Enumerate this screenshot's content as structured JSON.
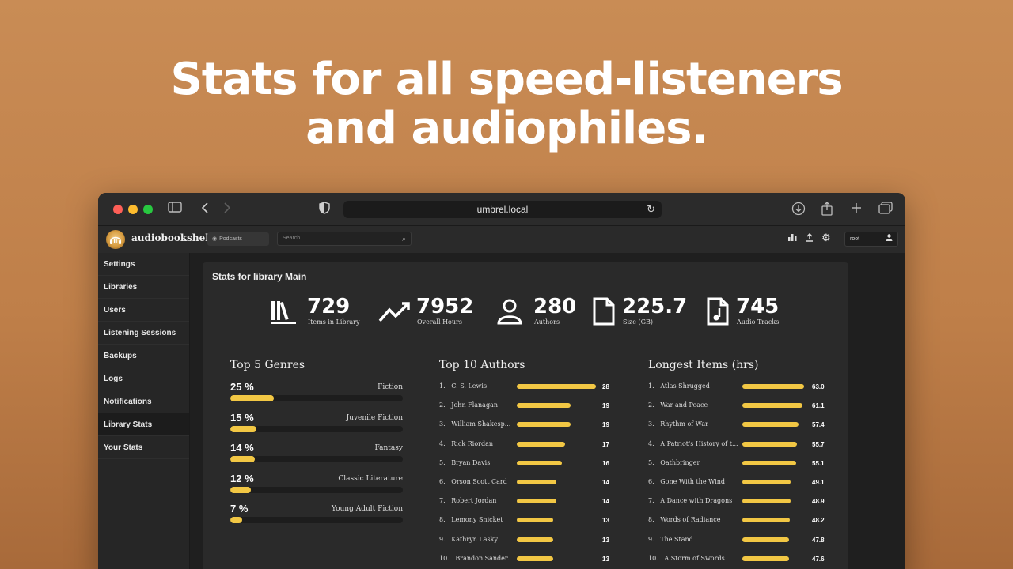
{
  "hero": {
    "line1": "Stats for all speed-listeners",
    "line2": "and audiophiles."
  },
  "browser": {
    "url": "umbrel.local",
    "icons": [
      "sidebar-icon",
      "back-icon",
      "forward-icon",
      "shield-icon",
      "reload-icon",
      "download-icon",
      "share-icon",
      "new-tab-icon",
      "tabs-icon"
    ]
  },
  "app": {
    "brand": "audiobookshelf",
    "library_select": "Podcasts",
    "search_placeholder": "Search..",
    "user": "root"
  },
  "sidebar": {
    "items": [
      {
        "label": "Settings"
      },
      {
        "label": "Libraries"
      },
      {
        "label": "Users"
      },
      {
        "label": "Listening Sessions"
      },
      {
        "label": "Backups"
      },
      {
        "label": "Logs"
      },
      {
        "label": "Notifications"
      },
      {
        "label": "Library Stats"
      },
      {
        "label": "Your Stats"
      }
    ],
    "active": "Library Stats"
  },
  "stats": {
    "title": "Stats for library Main",
    "items": [
      {
        "value": "729",
        "label": "Items in Library",
        "icon": "books-icon"
      },
      {
        "value": "7952",
        "label": "Overall Hours",
        "icon": "trend-icon"
      },
      {
        "value": "280",
        "label": "Authors",
        "icon": "person-icon"
      },
      {
        "value": "225.7",
        "label": "Size (GB)",
        "icon": "file-icon"
      },
      {
        "value": "745",
        "label": "Audio Tracks",
        "icon": "audio-file-icon"
      }
    ]
  },
  "genres": {
    "title": "Top 5 Genres",
    "items": [
      {
        "pct": "25 %",
        "name": "Fiction",
        "value": 25
      },
      {
        "pct": "15 %",
        "name": "Juvenile Fiction",
        "value": 15
      },
      {
        "pct": "14 %",
        "name": "Fantasy",
        "value": 14
      },
      {
        "pct": "12 %",
        "name": "Classic Literature",
        "value": 12
      },
      {
        "pct": "7 %",
        "name": "Young Adult Fiction",
        "value": 7
      }
    ]
  },
  "authors": {
    "title": "Top 10 Authors",
    "items": [
      {
        "rank": "1.",
        "name": "C. S. Lewis",
        "count": "28",
        "value": 28
      },
      {
        "rank": "2.",
        "name": "John Flanagan",
        "count": "19",
        "value": 19
      },
      {
        "rank": "3.",
        "name": "William Shakesp...",
        "count": "19",
        "value": 19
      },
      {
        "rank": "4.",
        "name": "Rick Riordan",
        "count": "17",
        "value": 17
      },
      {
        "rank": "5.",
        "name": "Bryan Davis",
        "count": "16",
        "value": 16
      },
      {
        "rank": "6.",
        "name": "Orson Scott Card",
        "count": "14",
        "value": 14
      },
      {
        "rank": "7.",
        "name": "Robert Jordan",
        "count": "14",
        "value": 14
      },
      {
        "rank": "8.",
        "name": "Lemony Snicket",
        "count": "13",
        "value": 13
      },
      {
        "rank": "9.",
        "name": "Kathryn Lasky",
        "count": "13",
        "value": 13
      },
      {
        "rank": "10.",
        "name": "Brandon Sander...",
        "count": "13",
        "value": 13
      }
    ]
  },
  "longest": {
    "title": "Longest Items (hrs)",
    "items": [
      {
        "rank": "1.",
        "name": "Atlas Shrugged",
        "hours": "63.0",
        "value": 63.0
      },
      {
        "rank": "2.",
        "name": "War and Peace",
        "hours": "61.1",
        "value": 61.1
      },
      {
        "rank": "3.",
        "name": "Rhythm of War",
        "hours": "57.4",
        "value": 57.4
      },
      {
        "rank": "4.",
        "name": "A Patriot's History of t...",
        "hours": "55.7",
        "value": 55.7
      },
      {
        "rank": "5.",
        "name": "Oathbringer",
        "hours": "55.1",
        "value": 55.1
      },
      {
        "rank": "6.",
        "name": "Gone With the Wind",
        "hours": "49.1",
        "value": 49.1
      },
      {
        "rank": "7.",
        "name": "A Dance with Dragons",
        "hours": "48.9",
        "value": 48.9
      },
      {
        "rank": "8.",
        "name": "Words of Radiance",
        "hours": "48.2",
        "value": 48.2
      },
      {
        "rank": "9.",
        "name": "The Stand",
        "hours": "47.8",
        "value": 47.8
      },
      {
        "rank": "10.",
        "name": "A Storm of Swords",
        "hours": "47.6",
        "value": 47.6
      }
    ]
  },
  "colors": {
    "accent": "#f2c744",
    "panel": "#2a2a2a",
    "background": "#c98c55"
  }
}
